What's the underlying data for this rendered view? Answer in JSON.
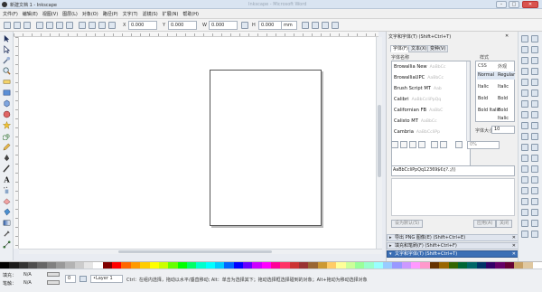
{
  "titlebar": {
    "title": "新建文档 1 - Inkscape",
    "ghost_title": "Inkscape - Microsoft Word",
    "minimize": "–",
    "maximize": "□",
    "close": "✕"
  },
  "menubar": {
    "items": [
      "文件(F)",
      "编辑(E)",
      "视图(V)",
      "图层(L)",
      "对象(O)",
      "路径(P)",
      "文字(T)",
      "滤镜(S)",
      "扩展(N)",
      "帮助(H)"
    ]
  },
  "toolbar": {
    "x_label": "X",
    "x_value": "0.000",
    "y_label": "Y",
    "y_value": "0.000",
    "w_label": "W",
    "w_value": "0.000",
    "h_label": "H",
    "h_value": "0.000",
    "unit": "mm"
  },
  "text_panel": {
    "title": "文字和字体(T) (Shift+Ctrl+T)",
    "tabs": [
      "字体(F)",
      "文本(X)",
      "变种(V)"
    ],
    "font_family_label": "字体名称",
    "style_label": "样式",
    "fonts": [
      {
        "name": "Browallia New",
        "sample": "AaBbCc"
      },
      {
        "name": "BrowalliaUPC",
        "sample": "AaBbCc"
      },
      {
        "name": "Brush Script MT",
        "sample": "Aab"
      },
      {
        "name": "Calibri",
        "sample": "AaBbCcIiPpQq"
      },
      {
        "name": "Californian FB",
        "sample": "AaBbC"
      },
      {
        "name": "Calisto MT",
        "sample": "AaBbCc"
      },
      {
        "name": "Cambria",
        "sample": "AaBbCcIiPp"
      }
    ],
    "style_headers": {
      "css": "CSS",
      "face": "外观"
    },
    "styles": [
      {
        "css": "Normal",
        "face": "Regular"
      },
      {
        "css": "Italic",
        "face": "Italic"
      },
      {
        "css": "Bold",
        "face": "Bold"
      },
      {
        "css": "Bold Italic",
        "face": "Bold Italic"
      }
    ],
    "size_label": "字体大小：",
    "size_value": "10",
    "spacing_value": "0%",
    "preview_text": "AaBbCcIiPpQq12369$€¢?.;/()",
    "set_default_button": "设为默认(S)",
    "apply_button": "应用(A)",
    "close_button": "关闭"
  },
  "docked_bars": [
    {
      "label": "导出 PNG 图像(E) (Shift+Ctrl+E)",
      "active": false
    },
    {
      "label": "填充和笔刷(F) (Shift+Ctrl+F)",
      "active": false
    },
    {
      "label": "文字和字体(T) (Shift+Ctrl+T)",
      "active": true
    }
  ],
  "statusbar": {
    "fill_label": "填充：",
    "fill_value": "N/A",
    "stroke_label": "笔触：",
    "stroke_value": "N/A",
    "opacity": "0",
    "layer": "•Layer 1",
    "message": "Ctrl：在组内选择，拖动以水平/垂直移动; Alt：单击为选择其下；拖动选择框选择碰到的对象；Alt+拖动为移动选择对象"
  },
  "colors": {
    "accent": "#3b6fb5",
    "palette": [
      "#000000",
      "#1a1a1a",
      "#333333",
      "#4d4d4d",
      "#666666",
      "#808080",
      "#999999",
      "#b3b3b3",
      "#cccccc",
      "#e6e6e6",
      "#ffffff",
      "#800000",
      "#ff0000",
      "#ff6600",
      "#ff9900",
      "#ffcc00",
      "#ffff00",
      "#ccff00",
      "#66ff00",
      "#00ff00",
      "#00ff66",
      "#00ffcc",
      "#00ffff",
      "#00ccff",
      "#0066ff",
      "#0000ff",
      "#6600ff",
      "#cc00ff",
      "#ff00ff",
      "#ff0099",
      "#ff3366",
      "#cc3333",
      "#993333",
      "#996633",
      "#cc9933",
      "#ffcc66",
      "#ffff99",
      "#ccff99",
      "#99ff99",
      "#99ffcc",
      "#99ffff",
      "#99ccff",
      "#9999ff",
      "#cc99ff",
      "#ff99ff",
      "#ff99cc",
      "#663300",
      "#996600",
      "#336600",
      "#006633",
      "#006666",
      "#003366",
      "#330066",
      "#660066",
      "#660033",
      "#c8a165",
      "#e0c8a0",
      "#ffffff"
    ]
  }
}
